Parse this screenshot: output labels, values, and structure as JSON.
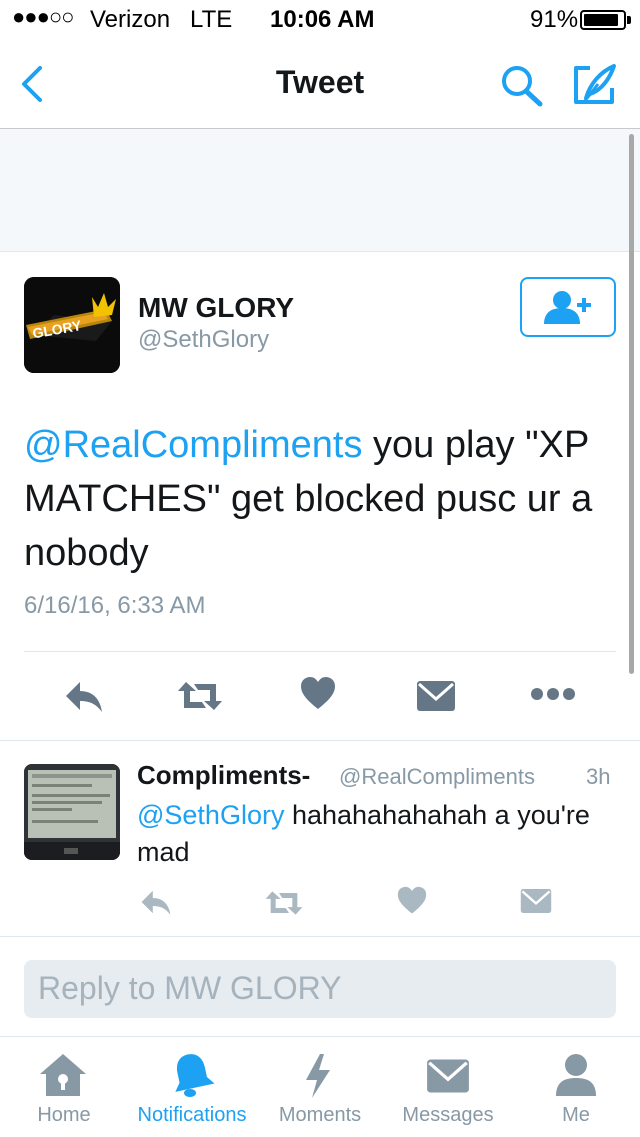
{
  "status_bar": {
    "signal_dots": "●●●○○",
    "carrier": "Verizon",
    "network": "LTE",
    "time": "10:06 AM",
    "battery_text": "91%",
    "battery_level": 0.91
  },
  "nav": {
    "title": "Tweet",
    "back_icon": "chevron-left-icon",
    "search_icon": "search-icon",
    "compose_icon": "compose-feather-icon",
    "accent_color": "#1da1f2"
  },
  "tweet": {
    "avatar_text": "GLORY",
    "display_name": "MW GLORY",
    "handle": "@SethGlory",
    "follow_icon": "follow-user-plus-icon",
    "mention": "@RealCompliments",
    "text": " you play \"XP MATCHES\" get blocked pusc ur a nobody",
    "timestamp": "6/16/16, 6:33 AM",
    "actions": [
      "reply-icon",
      "retweet-icon",
      "like-heart-icon",
      "direct-message-icon",
      "more-icon"
    ]
  },
  "reply_tweet": {
    "display_name": "Compliments-",
    "handle": "@RealCompliments",
    "time": "3h",
    "mention": "@SethGlory",
    "text": " hahahahahahah a you're mad",
    "actions": [
      "reply-icon",
      "retweet-icon",
      "like-heart-icon",
      "direct-message-icon"
    ]
  },
  "reply_box": {
    "placeholder": "Reply to MW GLORY"
  },
  "tab_bar": {
    "items": [
      {
        "label": "Home",
        "icon": "home-icon",
        "active": false
      },
      {
        "label": "Notifications",
        "icon": "bell-icon",
        "active": true
      },
      {
        "label": "Moments",
        "icon": "lightning-icon",
        "active": false
      },
      {
        "label": "Messages",
        "icon": "envelope-icon",
        "active": false
      },
      {
        "label": "Me",
        "icon": "person-icon",
        "active": false
      }
    ]
  }
}
